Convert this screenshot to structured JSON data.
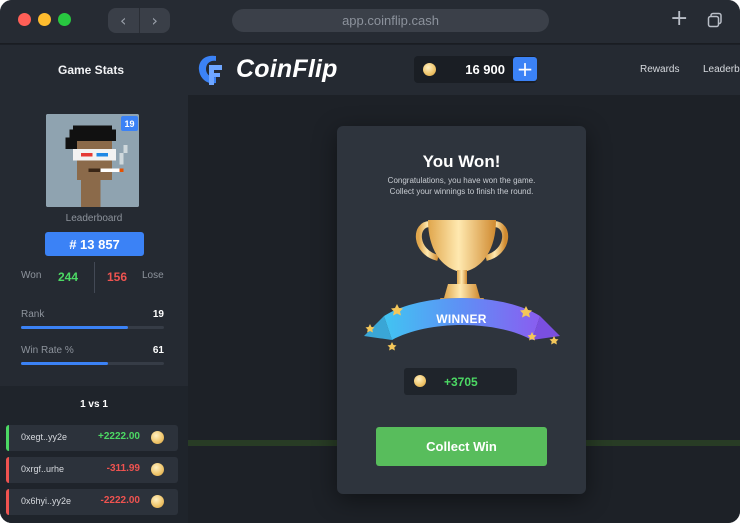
{
  "browser": {
    "url": "app.coinflip.cash",
    "back_glyph": "‹",
    "forward_glyph": "›",
    "new_tab_glyph": "+"
  },
  "header": {
    "game_stats_label": "Game Stats",
    "logo_text": "CoinFlip",
    "balance": "16 900",
    "add_glyph": "+",
    "nav": {
      "rewards": "Rewards",
      "leaderboard": "Leaderbo"
    }
  },
  "profile": {
    "level_badge": "19",
    "leaderboard_label": "Leaderboard",
    "leaderboard_rank": "# 13 857",
    "won_label": "Won",
    "won": "244",
    "lost": "156",
    "lose_label": "Lose",
    "rank_label": "Rank",
    "rank": "19",
    "rank_progress": 0.75,
    "win_rate_label": "Win Rate %",
    "win_rate": "61",
    "win_rate_progress": 0.61
  },
  "vs_panel": {
    "title": "1 vs 1",
    "history": [
      {
        "address": "0xegt..yy2e",
        "amount": "+2222.00",
        "result": "win"
      },
      {
        "address": "0xrgf..urhe",
        "amount": "-311.99",
        "result": "loss"
      },
      {
        "address": "0x6hyi..yy2e",
        "amount": "-2222.00",
        "result": "loss"
      }
    ]
  },
  "modal": {
    "title": "You Won!",
    "subtitle_line1": "Congratulations, you have won the game.",
    "subtitle_line2": "Collect your winnings to finish the round.",
    "banner": "WINNER",
    "prize": "+3705",
    "collect_button": "Collect Win"
  },
  "colors": {
    "accent_blue": "#3b82f6",
    "win_green": "#4cd964",
    "loss_red": "#ef5350",
    "button_green": "#58bd5c",
    "coin_gold": "#f0c76e"
  },
  "icons": {
    "back": "chevron-left-icon",
    "forward": "chevron-right-icon",
    "new_tab": "plus-icon",
    "tabs": "tabs-icon",
    "logo": "coinflip-logo-icon",
    "coin": "coin-icon",
    "trophy": "trophy-icon"
  }
}
